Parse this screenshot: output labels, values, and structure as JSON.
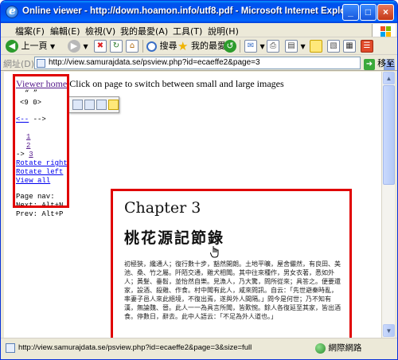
{
  "window": {
    "title": "Online viewer - http://down.hoamon.info/utf8.pdf - Microsoft Internet Explorer"
  },
  "menu": [
    "檔案(F)",
    "編輯(E)",
    "檢視(V)",
    "我的最愛(A)",
    "工具(T)",
    "說明(H)"
  ],
  "toolbar": {
    "back_label": "上一頁",
    "search_label": "搜尋",
    "favorites_label": "我的最愛"
  },
  "address": {
    "label": "網址(D)",
    "url": "http://view.samurajdata.se/psview.php?id=ecaeffe2&page=3",
    "go_label": "移至"
  },
  "page": {
    "viewer_home": "Viewer home",
    "instruction": " Click on page to switch between small and large images",
    "nav_quote": "“ ”",
    "nav_arrows": "<9 0>",
    "back_link": "<--",
    "back_suffix": "-->",
    "pages": [
      "1",
      "2",
      "3"
    ],
    "current_marker": "->",
    "rotate_right": "Rotate right",
    "rotate_left": "Rotate left",
    "view_all": "View all",
    "page_nav_label": "Page nav:",
    "next_hint": "Next: Alt+N",
    "prev_hint": "Prev: Alt+P"
  },
  "pdf": {
    "chapter": "Chapter 3",
    "title": "桃花源記節錄",
    "body": "初極狹，纔通人；復行數十步，豁然開朗。土地平曠，屋舍儼然，有良田、美池、桑、竹之屬。阡陌交通，雞犬相聞。其中往來種作，男女衣著，悉如外人；黃髮、垂髫，並怡然自樂。見漁人，乃大驚，問所從來；具答之。便要還家，設酒、殺雞、作食。村中聞有此人，咸來問訊。自云：「先世避秦時亂，率妻子邑人來此絕境，不復出焉，遂與外人間隔。」問今是何世；乃不知有漢，無論魏、晉。此人一一為具言所聞，皆歎惋。餘人各復延至其家，皆出酒食。停數日，辭去。此中人語云：「不足為外人道也。」"
  },
  "status": {
    "text": "http://view.samurajdata.se/psview.php?id=ecaeffe2&page=3&size=full",
    "zone": "網際網路"
  },
  "colors": {
    "highlight_border": "#e00000",
    "titlebar": "#0053ee",
    "link": "#0000ee",
    "visited_link": "#551a8b"
  }
}
